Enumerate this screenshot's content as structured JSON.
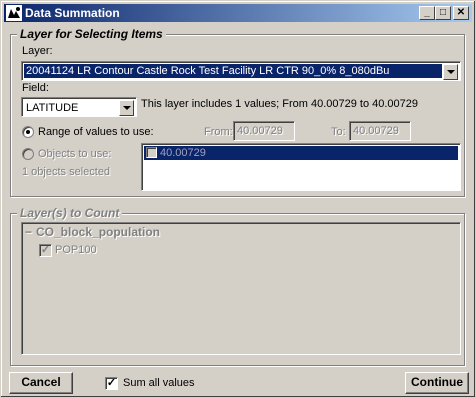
{
  "window": {
    "title": "Data Summation",
    "minimize": "_",
    "maximize": "□",
    "close": "✕"
  },
  "selecting_group": {
    "legend": "Layer for Selecting Items",
    "layer_label": "Layer:",
    "layer_value": "20041124 LR Contour Castle Rock Test Facility LR CTR 90_0% 8_080dBu",
    "field_label": "Field:",
    "field_value": "LATITUDE",
    "info_text": "This layer includes 1 values; From 40.00729 to 40.00729",
    "range_label": "Range of values to use:",
    "from_label": "From:",
    "from_value": "40.00729",
    "to_label": "To:",
    "to_value": "40.00729",
    "objects_label": "Objects to use:",
    "objects_selected": "1 objects selected",
    "objects_list": [
      {
        "label": "40.00729",
        "checked": false
      }
    ]
  },
  "count_group": {
    "legend": "Layer(s) to Count",
    "tree_root": "CO_block_population",
    "tree_child": "POP100",
    "tree_child_checked": true
  },
  "footer": {
    "cancel_label": "Cancel",
    "sum_all_label": "Sum all values",
    "sum_all_checked": true,
    "continue_label": "Continue"
  },
  "colors": {
    "title_gradient_start": "#0a246a",
    "title_gradient_end": "#a6caf0",
    "selection": "#0a246a",
    "face": "#d4d0c8"
  }
}
